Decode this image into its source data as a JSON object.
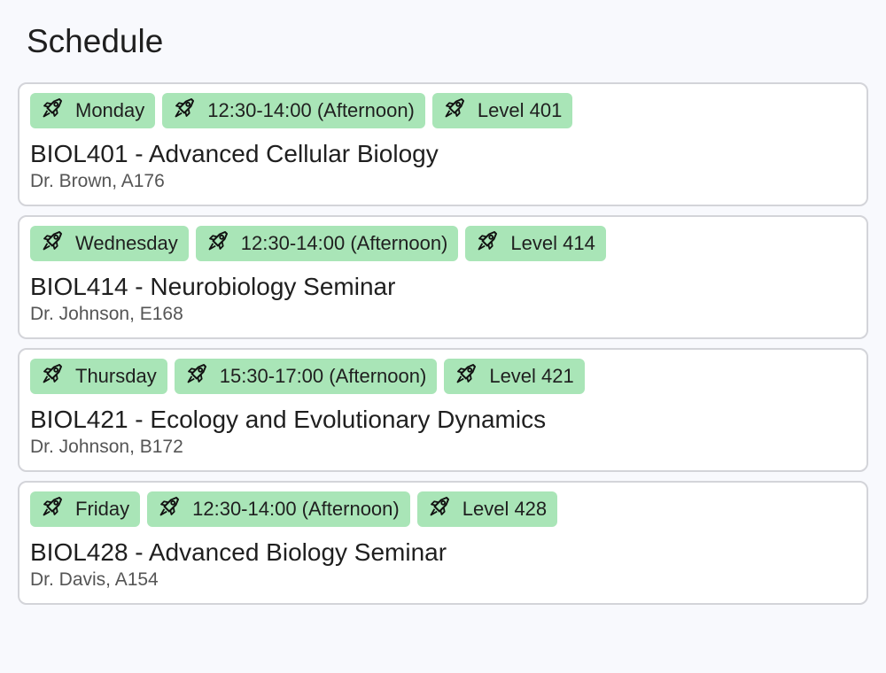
{
  "page": {
    "title": "Schedule"
  },
  "icons": {
    "tag_icon": "rocket-icon"
  },
  "colors": {
    "background": "#f8f9fd",
    "card": "#ffffff",
    "card_border": "#d3d4d9",
    "tag_background": "#a9e5b7",
    "text": "#1f1f1f",
    "meta_text": "#555555"
  },
  "courses": [
    {
      "day": "Monday",
      "time": "12:30-14:00 (Afternoon)",
      "level": "Level 401",
      "title": "BIOL401 - Advanced Cellular Biology",
      "meta": "Dr. Brown, A176"
    },
    {
      "day": "Wednesday",
      "time": "12:30-14:00 (Afternoon)",
      "level": "Level 414",
      "title": "BIOL414 - Neurobiology Seminar",
      "meta": "Dr. Johnson, E168"
    },
    {
      "day": "Thursday",
      "time": "15:30-17:00 (Afternoon)",
      "level": "Level 421",
      "title": "BIOL421 - Ecology and Evolutionary Dynamics",
      "meta": "Dr. Johnson, B172"
    },
    {
      "day": "Friday",
      "time": "12:30-14:00 (Afternoon)",
      "level": "Level 428",
      "title": "BIOL428 - Advanced Biology Seminar",
      "meta": "Dr. Davis, A154"
    }
  ]
}
